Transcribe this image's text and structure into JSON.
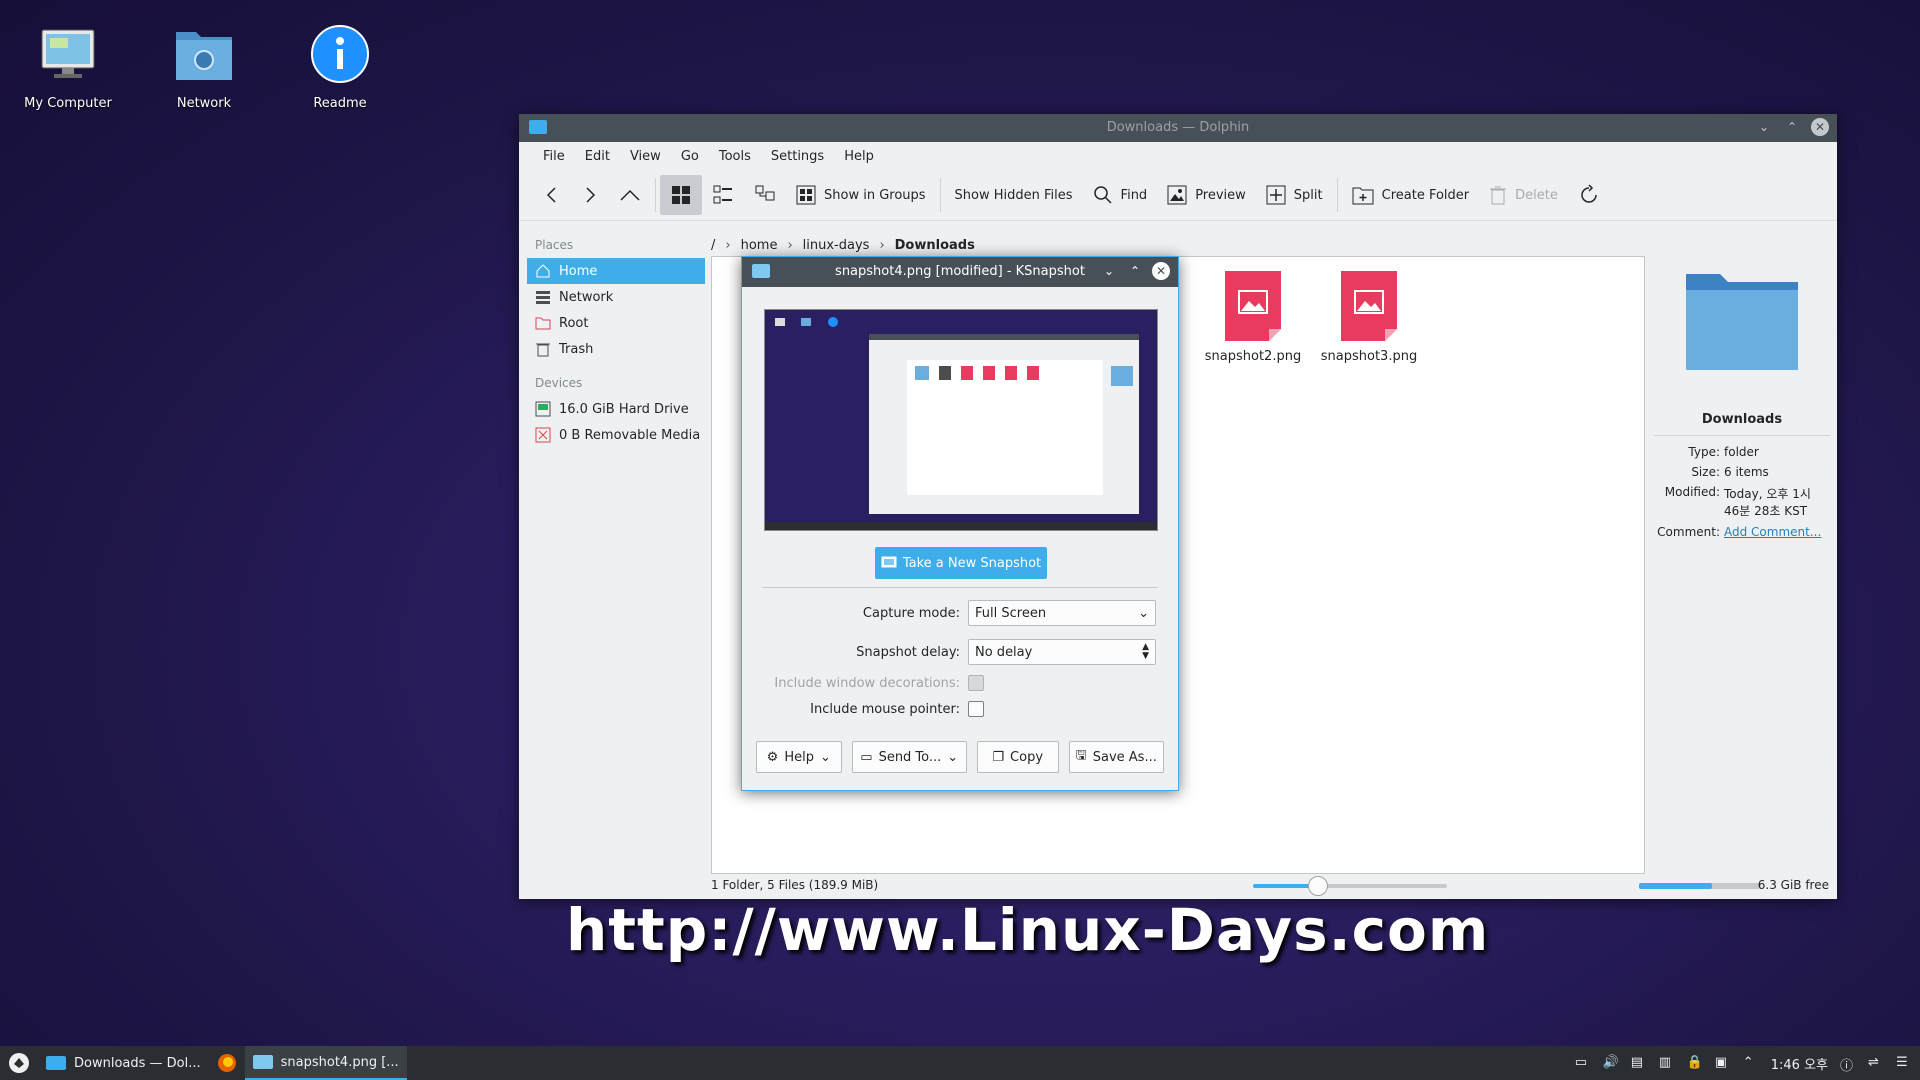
{
  "desktop": {
    "icons": [
      {
        "label": "My Computer",
        "icon": "computer-icon"
      },
      {
        "label": "Network",
        "icon": "network-folder-icon"
      },
      {
        "label": "Readme",
        "icon": "info-icon"
      }
    ]
  },
  "dolphin": {
    "title": "Downloads — Dolphin",
    "menu": [
      "File",
      "Edit",
      "View",
      "Go",
      "Tools",
      "Settings",
      "Help"
    ],
    "toolbar": {
      "show_in_groups": "Show in Groups",
      "show_hidden": "Show Hidden Files",
      "find": "Find",
      "preview": "Preview",
      "split": "Split",
      "create_folder": "Create Folder",
      "delete": "Delete"
    },
    "places_header": "Places",
    "places": [
      "Home",
      "Network",
      "Root",
      "Trash"
    ],
    "devices_header": "Devices",
    "devices": [
      "16.0 GiB Hard Drive",
      "0 B Removable Media"
    ],
    "breadcrumb": [
      "/",
      "home",
      "linux-days",
      "Downloads"
    ],
    "files": [
      "snapshot2.png",
      "snapshot3.png"
    ],
    "info": {
      "name": "Downloads",
      "type_k": "Type:",
      "type_v": "folder",
      "size_k": "Size:",
      "size_v": "6 items",
      "modified_k": "Modified:",
      "modified_v": "Today, 오후 1시 46분 28초 KST",
      "comment_k": "Comment:",
      "comment_v": "Add Comment..."
    },
    "status": {
      "summary": "1 Folder, 5 Files (189.9 MiB)",
      "free": "6.3 GiB free",
      "zoom_fraction": 0.33,
      "used_fraction": 0.6
    }
  },
  "ksnapshot": {
    "title": "snapshot4.png [modified] - KSnapshot",
    "new_snapshot": "Take a New Snapshot",
    "capture_mode_label": "Capture mode:",
    "capture_mode_value": "Full Screen",
    "delay_label": "Snapshot delay:",
    "delay_value": "No delay",
    "window_decor_label": "Include window decorations:",
    "mouse_pointer_label": "Include mouse pointer:",
    "buttons": {
      "help": "Help",
      "send_to": "Send To...",
      "copy": "Copy",
      "save_as": "Save As..."
    }
  },
  "watermark": "http://www.Linux-Days.com",
  "taskbar": {
    "tasks": [
      "Downloads — Dol...",
      "snapshot4.png [..."
    ],
    "clock": "1:46 오후"
  },
  "colors": {
    "accent": "#3daee9",
    "titlebar": "#475057",
    "panel": "#2a2e32"
  }
}
